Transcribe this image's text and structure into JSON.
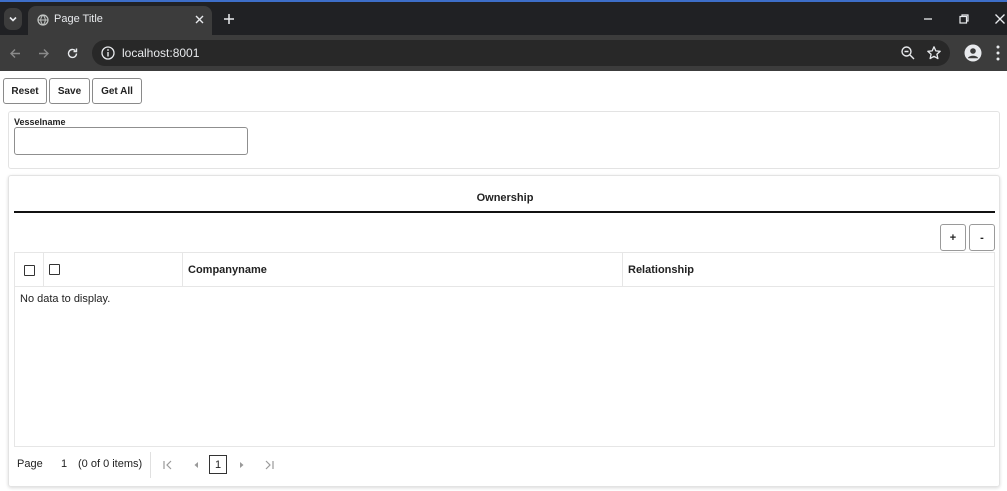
{
  "browser": {
    "tab_title": "Page Title",
    "url": "localhost:8001"
  },
  "toolbar": {
    "reset_label": "Reset",
    "save_label": "Save",
    "get_all_label": "Get All"
  },
  "form": {
    "vesselname_label": "Vesselname",
    "vesselname_value": ""
  },
  "ownership": {
    "title": "Ownership",
    "add_label": "+",
    "remove_label": "-",
    "columns": [
      "Companyname",
      "Relationship"
    ],
    "empty_message": "No data to display."
  },
  "pager": {
    "page_label": "Page",
    "page_value": "1",
    "items_text": "(0 of 0 items)",
    "current_page": "1"
  }
}
